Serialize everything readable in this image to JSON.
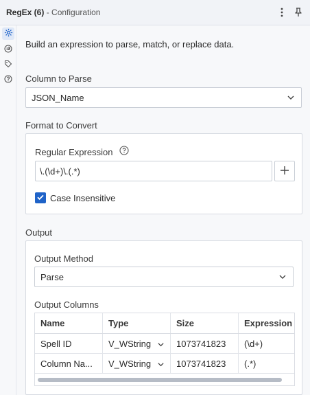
{
  "window": {
    "title": "RegEx (6)",
    "subtitle": "- Configuration"
  },
  "sidebar": {
    "items": [
      {
        "name": "configuration",
        "icon": "gear-icon",
        "active": true
      },
      {
        "name": "annotation",
        "icon": "arrows-icon",
        "active": false
      },
      {
        "name": "tags",
        "icon": "tag-icon",
        "active": false
      },
      {
        "name": "help",
        "icon": "help-icon",
        "active": false
      }
    ]
  },
  "intro": "Build an expression to parse, match, or replace data.",
  "column_to_parse": {
    "label": "Column to Parse",
    "value": "JSON_Name"
  },
  "format_to_convert": {
    "label": "Format to Convert",
    "regex_label": "Regular Expression",
    "regex_value": "\\.(\\d+)\\.(.*)",
    "case_insensitive_label": "Case Insensitive",
    "case_insensitive_checked": true
  },
  "output": {
    "label": "Output",
    "method_label": "Output Method",
    "method_value": "Parse",
    "columns_label": "Output Columns",
    "columns": {
      "headers": [
        "Name",
        "Type",
        "Size",
        "Expression"
      ],
      "rows": [
        {
          "name": "Spell ID",
          "type": "V_WString",
          "size": "1073741823",
          "expression": "(\\d+)"
        },
        {
          "name": "Column Na...",
          "type": "V_WString",
          "size": "1073741823",
          "expression": "(.*)"
        }
      ]
    }
  },
  "colors": {
    "accent": "#1f63c8",
    "panel_bg": "#f7f8fa",
    "titlebar_bg": "#f1f3f7",
    "border": "#c9ced6",
    "muted_text": "#9aa3b1"
  }
}
